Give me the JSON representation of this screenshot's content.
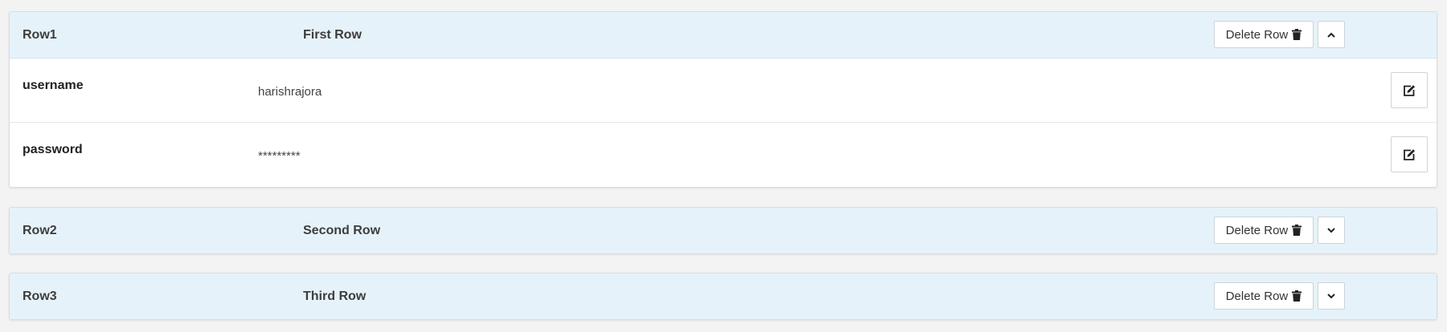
{
  "rows": [
    {
      "id": "Row1",
      "name": "First Row",
      "delete_label": "Delete Row",
      "expanded": true,
      "toggle_icon": "chevron-up-icon",
      "fields": [
        {
          "label": "username",
          "value": "harishrajora"
        },
        {
          "label": "password",
          "value": "*********"
        }
      ]
    },
    {
      "id": "Row2",
      "name": "Second Row",
      "delete_label": "Delete Row",
      "expanded": false,
      "toggle_icon": "chevron-down-icon"
    },
    {
      "id": "Row3",
      "name": "Third Row",
      "delete_label": "Delete Row",
      "expanded": false,
      "toggle_icon": "chevron-down-icon"
    }
  ],
  "colors": {
    "header_bg": "#e6f2fa",
    "page_bg": "#f3f3f3",
    "panel_bg": "#ffffff",
    "border": "#d9dde0"
  }
}
